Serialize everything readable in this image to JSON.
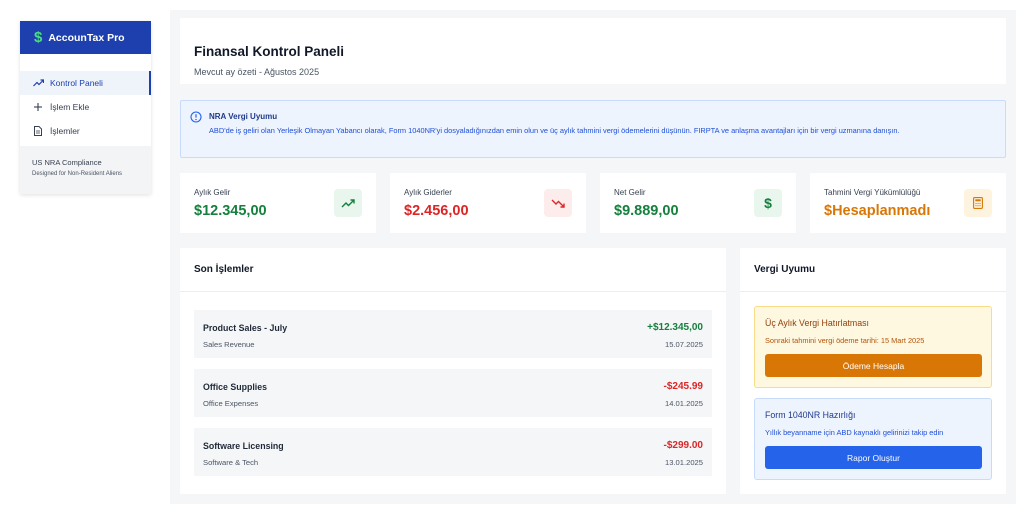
{
  "app": {
    "name": "AccounTax Pro",
    "logo_icon": "dollar-icon"
  },
  "sidebar": {
    "items": [
      {
        "label": "Kontrol Paneli",
        "icon": "trending-up-icon",
        "active": true
      },
      {
        "label": "İşlem Ekle",
        "icon": "plus-icon",
        "active": false
      },
      {
        "label": "İşlemler",
        "icon": "document-icon",
        "active": false
      }
    ],
    "footer": {
      "title": "US NRA Compliance",
      "subtitle": "Designed for Non-Resident Aliens"
    }
  },
  "header": {
    "title": "Finansal Kontrol Paneli",
    "subtitle": "Mevcut ay özeti - Ağustos 2025"
  },
  "alert": {
    "icon": "info-icon",
    "title": "NRA Vergi Uyumu",
    "text": "ABD'de iş geliri olan Yerleşik Olmayan Yabancı olarak, Form 1040NR'yi dosyaladığınızdan emin olun ve üç aylık tahmini vergi ödemelerini düşünün. FIRPTA ve anlaşma avantajları için bir vergi uzmanına danışın."
  },
  "stats": [
    {
      "label": "Aylık Gelir",
      "value": "$12.345,00",
      "icon": "trending-up-icon",
      "color": "#15803d"
    },
    {
      "label": "Aylık Giderler",
      "value": "$2.456,00",
      "icon": "trending-down-icon",
      "color": "#dc2626"
    },
    {
      "label": "Net Gelir",
      "value": "$9.889,00",
      "icon": "dollar-icon",
      "color": "#15803d"
    },
    {
      "label": "Tahmini Vergi Yükümlülüğü",
      "value": "$Hesaplanmadı",
      "icon": "calculator-icon",
      "color": "#d97706"
    }
  ],
  "transactions": {
    "title": "Son İşlemler",
    "items": [
      {
        "name": "Product Sales - July",
        "category": "Sales Revenue",
        "amount": "+$12.345,00",
        "date": "15.07.2025",
        "type": "income"
      },
      {
        "name": "Office Supplies",
        "category": "Office Expenses",
        "amount": "-$245.99",
        "date": "14.01.2025",
        "type": "expense"
      },
      {
        "name": "Software Licensing",
        "category": "Software & Tech",
        "amount": "-$299.00",
        "date": "13.01.2025",
        "type": "expense"
      }
    ]
  },
  "tax": {
    "title": "Vergi Uyumu",
    "reminder": {
      "title": "Üç Aylık Vergi Hatırlatması",
      "text": "Sonraki tahmini vergi ödeme tarihi: 15 Mart 2025",
      "button": "Ödeme Hesapla"
    },
    "form": {
      "title": "Form 1040NR Hazırlığı",
      "text": "Yıllık beyanname için ABD kaynaklı gelirinizi takip edin",
      "button": "Rapor Oluştur"
    }
  },
  "colors": {
    "brand": "#1e40af",
    "income": "#15803d",
    "expense": "#dc2626",
    "warning": "#d97706",
    "info": "#2563eb"
  }
}
